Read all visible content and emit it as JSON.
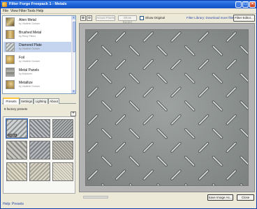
{
  "window": {
    "title": "Filter Forge Freepack 1 - Metals"
  },
  "menu": [
    "File",
    "View",
    "Filter",
    "Tools",
    "Help"
  ],
  "filters": [
    {
      "name": "Alien Metal",
      "author": "by Vladimir Golovin"
    },
    {
      "name": "Brushed Metal",
      "author": "by Rinny Filters"
    },
    {
      "name": "Diamond Plate",
      "author": "by Vladimir Golovin"
    },
    {
      "name": "Foil",
      "author": "by Vladimir Golovin"
    },
    {
      "name": "Metal Panels",
      "author": "by Moloberk"
    },
    {
      "name": "Metallize",
      "author": "by Vladimir Golovin"
    }
  ],
  "tabs": [
    "Presets",
    "Settings",
    "Lighting",
    "About"
  ],
  "presets": {
    "count_label": "8 factory presets",
    "add_symbol": "+",
    "first_label": "Default",
    "items": 9
  },
  "help_link": "Help: Presets",
  "toolbar": {
    "zoom_in_icon": "zoom-in-icon",
    "zoom_out_icon": "zoom-out-icon",
    "actual_pixels": "Actual Pixels",
    "show_border": "Show Border",
    "show_original": "Show Original",
    "library_link": "Filter Library: Download more filters",
    "filter_editor": "Filter Editor..."
  },
  "bottom": {
    "save_image": "Save Image As...",
    "close": "Close"
  },
  "colors": {
    "titlebar": "#1a5fd6",
    "link": "#2a49a8",
    "selection": "#c5d5ef",
    "tab_accent": "#ffc83c"
  }
}
